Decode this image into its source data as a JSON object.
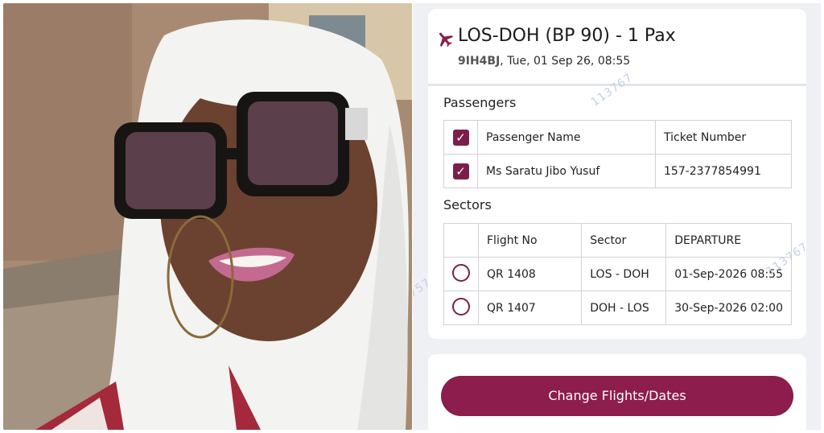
{
  "booking": {
    "title": "LOS-DOH (BP 90) - 1 Pax",
    "ref": "9IH4BJ",
    "date_line": ", Tue, 01 Sep 26, 08:55"
  },
  "passengers": {
    "label": "Passengers",
    "headers": [
      "Passenger Name",
      "Ticket Number"
    ],
    "rows": [
      {
        "name": "Ms Saratu Jibo Yusuf",
        "ticket": "157-2377854991"
      }
    ]
  },
  "sectors": {
    "label": "Sectors",
    "headers": [
      "Flight No",
      "Sector",
      "DEPARTURE"
    ],
    "rows": [
      {
        "flight": "QR 1408",
        "sector": "LOS - DOH",
        "departure": "01-Sep-2026 08:55"
      },
      {
        "flight": "QR 1407",
        "sector": "DOH - LOS",
        "departure": "30-Sep-2026 02:00"
      }
    ]
  },
  "watermarks": [
    "113767",
    "113767",
    "757"
  ],
  "actions": {
    "change_label": "Change Flights/Dates"
  },
  "icons": {
    "title_icon": "airplane-icon",
    "checkbox": "checkbox-checked-icon",
    "radio": "radio-unchecked-icon"
  },
  "colors": {
    "accent": "#8c1d4c",
    "background": "#eef0f4"
  }
}
